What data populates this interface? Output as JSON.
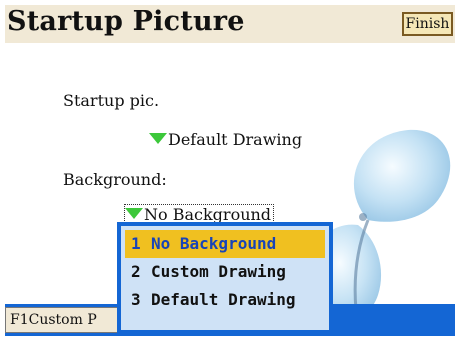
{
  "header": {
    "title": "Startup Picture",
    "finish_label": "Finish"
  },
  "startup": {
    "label": "Startup pic.",
    "value": "Default Drawing"
  },
  "background": {
    "label": "Background:",
    "value": "No Background"
  },
  "popup": {
    "options": [
      {
        "num": "1",
        "label": "No Background",
        "selected": true
      },
      {
        "num": "2",
        "label": "Custom Drawing",
        "selected": false
      },
      {
        "num": "3",
        "label": "Default Drawing",
        "selected": false
      }
    ]
  },
  "status": {
    "text": "F1Custom P"
  },
  "colors": {
    "accent": "#1466d4",
    "title_bg": "#f1e9d6",
    "highlight": "#f0c020",
    "arrow": "#3cc83a"
  }
}
